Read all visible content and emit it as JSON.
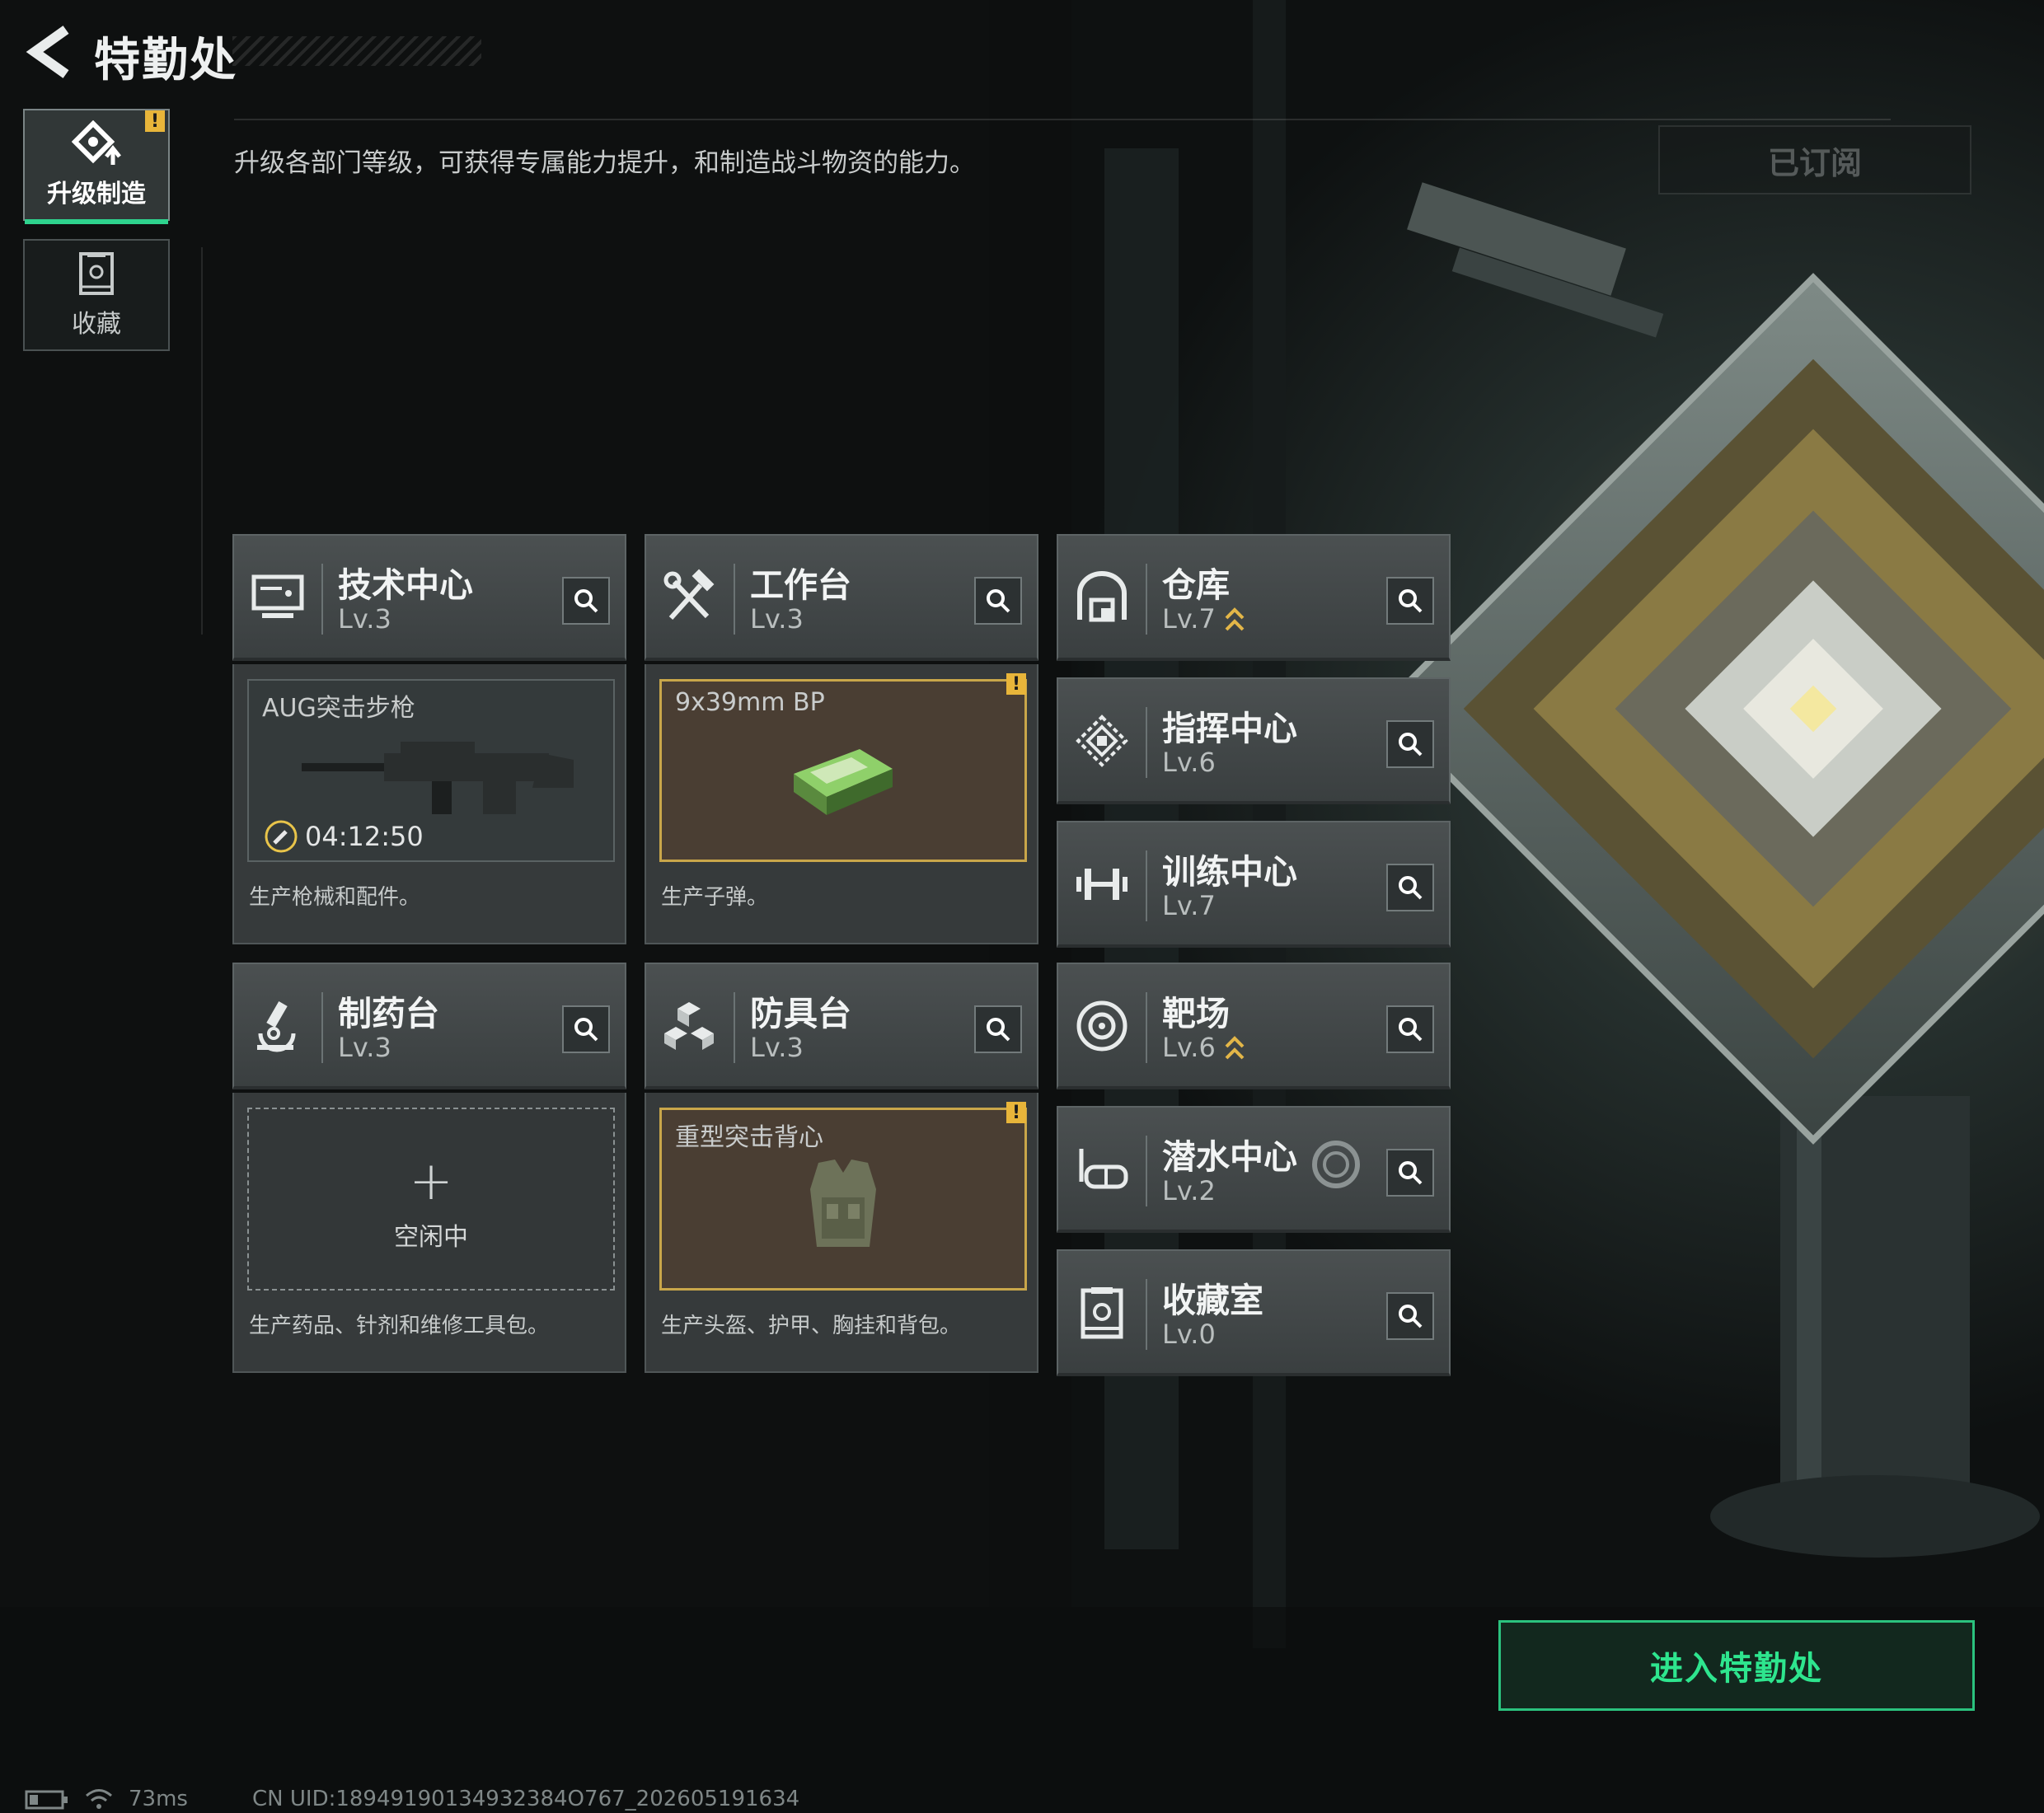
{
  "header": {
    "title": "特勤处",
    "description": "升级各部门等级，可获得专属能力提升，和制造战斗物资的能力。",
    "subscribed_label": "已订阅"
  },
  "side_tabs": [
    {
      "label": "升级制造",
      "active": true,
      "alert": "!"
    },
    {
      "label": "收藏",
      "active": false
    }
  ],
  "departments": {
    "tech_center": {
      "name": "技术中心",
      "level": "Lv.3"
    },
    "workbench": {
      "name": "工作台",
      "level": "Lv.3"
    },
    "warehouse": {
      "name": "仓库",
      "level": "Lv.7",
      "upgradable": true
    },
    "command_center": {
      "name": "指挥中心",
      "level": "Lv.6"
    },
    "training_center": {
      "name": "训练中心",
      "level": "Lv.7"
    },
    "pharmacy": {
      "name": "制药台",
      "level": "Lv.3"
    },
    "armor_bench": {
      "name": "防具台",
      "level": "Lv.3"
    },
    "shooting_range": {
      "name": "靶场",
      "level": "Lv.6",
      "upgradable": true
    },
    "diving_center": {
      "name": "潜水中心",
      "level": "Lv.2"
    },
    "collection_room": {
      "name": "收藏室",
      "level": "Lv.0"
    }
  },
  "production": {
    "tech_center": {
      "item": "AUG突击步枪",
      "timer": "04:12:50",
      "desc": "生产枪械和配件。"
    },
    "workbench": {
      "item": "9x39mm BP",
      "alert": "!",
      "desc": "生产子弹。"
    },
    "pharmacy": {
      "plus": "+",
      "status": "空闲中",
      "desc": "生产药品、针剂和维修工具包。"
    },
    "armor_bench": {
      "item": "重型突击背心",
      "alert": "!",
      "desc": "生产头盔、护甲、胸挂和背包。"
    }
  },
  "enter_button": "进入特勤处",
  "statusbar": {
    "ping": "73ms",
    "uid": "CN UID:18949190134932384O767_202605191634"
  },
  "colors": {
    "accent_green": "#2ed38e",
    "warning_yellow": "#e8b53a",
    "slot_gold_border": "#c9a64a"
  }
}
